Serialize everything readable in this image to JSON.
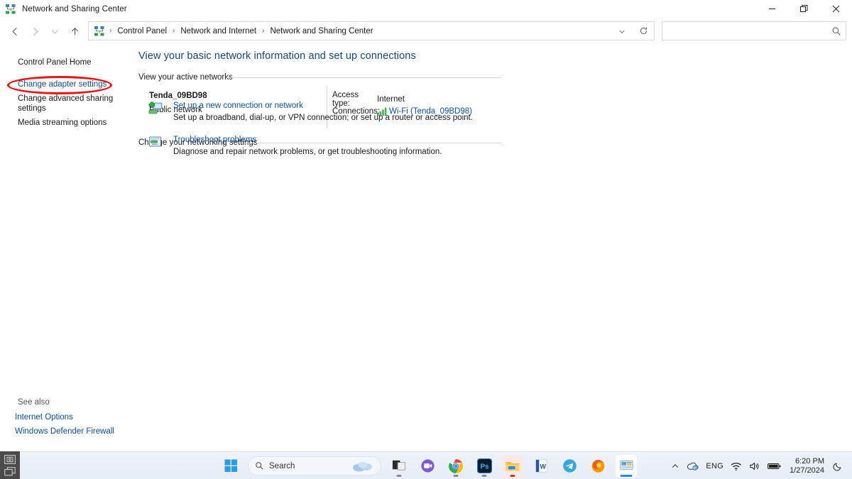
{
  "window": {
    "title": "Network and Sharing Center",
    "icon": "network-icon",
    "controls": {
      "minimize": "–",
      "restore": "❐",
      "close": "✕"
    }
  },
  "nav": {
    "back": "back-arrow",
    "forward": "forward-arrow",
    "recent": "chevron-down",
    "up": "up-arrow",
    "refresh": "refresh-icon",
    "dropdown": "chevron-down"
  },
  "address": {
    "breadcrumbs": [
      "Control Panel",
      "Network and Internet",
      "Network and Sharing Center"
    ],
    "separator": "›"
  },
  "search": {
    "value": "",
    "placeholder": "",
    "icon": "search-icon"
  },
  "sidebar": {
    "home": "Control Panel Home",
    "links": [
      {
        "label": "Change adapter settings",
        "highlighted": true
      },
      {
        "label": "Change advanced sharing settings",
        "highlighted": false
      },
      {
        "label": "Media streaming options",
        "highlighted": false
      }
    ],
    "see_also_label": "See also",
    "see_also": [
      "Internet Options",
      "Windows Defender Firewall"
    ]
  },
  "main": {
    "page_title": "View your basic network information and set up connections",
    "active_networks_header": "View your active networks",
    "network": {
      "name": "Tenda_09BD98",
      "type": "Public network",
      "access_type_label": "Access type:",
      "access_type_value": "Internet",
      "connections_label": "Connections:",
      "connection_link": "Wi-Fi (Tenda_09BD98)",
      "connection_icon": "wifi-signal-icon"
    },
    "change_settings_header": "Change your networking settings",
    "tasks": [
      {
        "icon": "new-connection-icon",
        "link": "Set up a new connection or network",
        "desc": "Set up a broadband, dial-up, or VPN connection; or set up a router or access point."
      },
      {
        "icon": "troubleshoot-icon",
        "link": "Troubleshoot problems",
        "desc": "Diagnose and repair network problems, or get troubleshooting information."
      }
    ]
  },
  "taskbar": {
    "start": "windows-start-icon",
    "search": {
      "placeholder": "Search",
      "icon": "search-icon",
      "weather": "weather-cloud-icon"
    },
    "apps": [
      {
        "name": "task-view-icon"
      },
      {
        "name": "chat-icon"
      },
      {
        "name": "chrome-icon"
      },
      {
        "name": "photoshop-icon"
      },
      {
        "name": "file-explorer-icon"
      },
      {
        "name": "word-icon"
      },
      {
        "name": "telegram-icon"
      },
      {
        "name": "firefox-icon"
      },
      {
        "name": "control-panel-icon"
      }
    ],
    "tray": {
      "overflow": "chevron-up-icon",
      "onedrive": "onedrive-icon",
      "language": "ENG",
      "wifi": "wifi-icon",
      "volume": "speaker-icon",
      "battery": "battery-icon",
      "time": "6:20 PM",
      "date": "1/27/2024",
      "notifications": "moon-icon"
    }
  },
  "capture_widget": {
    "region": "region-capture-icon",
    "window": "window-capture-icon"
  },
  "colors": {
    "link": "#0b4f9e",
    "title": "#13477d",
    "annotation": "#ee1111"
  }
}
